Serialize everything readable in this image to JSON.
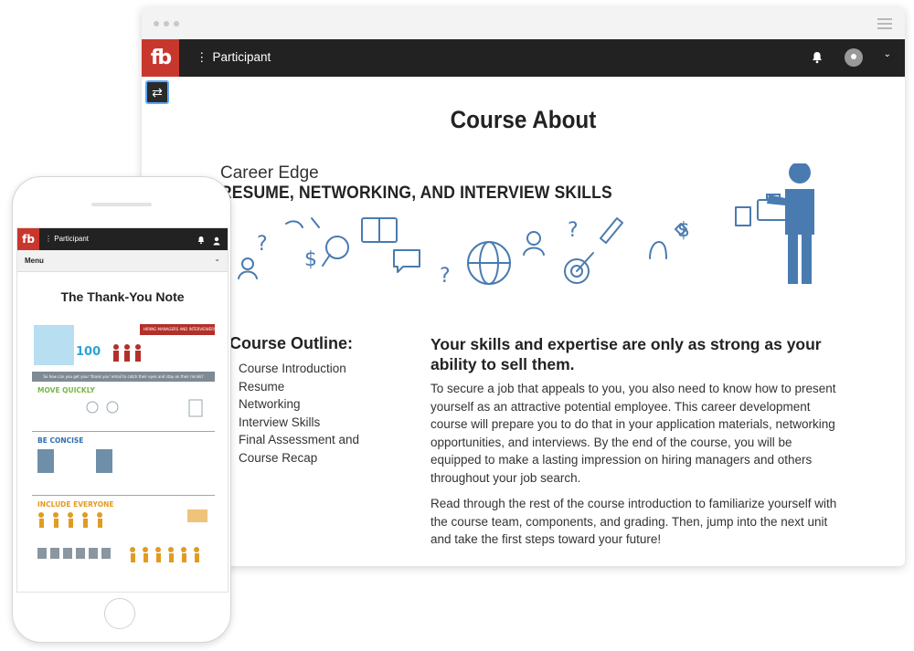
{
  "desktop": {
    "app": {
      "role_label": "Participant"
    },
    "page": {
      "title": "Course About",
      "banner": {
        "subtitle": "Career Edge",
        "heading": "RESUME, NETWORKING, AND INTERVIEW SKILLS"
      },
      "outline": {
        "heading": "Course Outline:",
        "items": [
          "Course Introduction",
          "Resume",
          "Networking",
          "Interview Skills",
          "Final Assessment and Course Recap"
        ]
      },
      "main": {
        "heading": "Your skills and expertise are only as strong as your ability to sell them.",
        "para1": "To secure a job that appeals to you, you also need to know how to present yourself as an attractive potential employee. This career development course will prepare you to do that in your application materials, networking opportunities, and interviews. By the end of the course, you will be equipped to make a lasting impression on hiring managers and others throughout your job search.",
        "para2": "Read through the rest of the course introduction to familiarize yourself with the course team, components, and grading. Then, jump into the next unit and take the first steps toward your future!"
      }
    }
  },
  "mobile": {
    "app": {
      "role_label": "Participant"
    },
    "menu_label": "Menu",
    "page_title": "The Thank-You Note",
    "infographic": {
      "stat": "100",
      "header": "HIRING MANAGERS AND INTERVIEWERS...",
      "band": "So how can you get your 'thank you' email to catch their eyes and stay on their minds?",
      "sections": [
        "MOVE QUICKLY",
        "BE CONCISE",
        "INCLUDE EVERYONE"
      ]
    }
  },
  "colors": {
    "brand_red": "#c8372d",
    "appbar": "#222222",
    "accent_blue": "#4a7bb0"
  }
}
